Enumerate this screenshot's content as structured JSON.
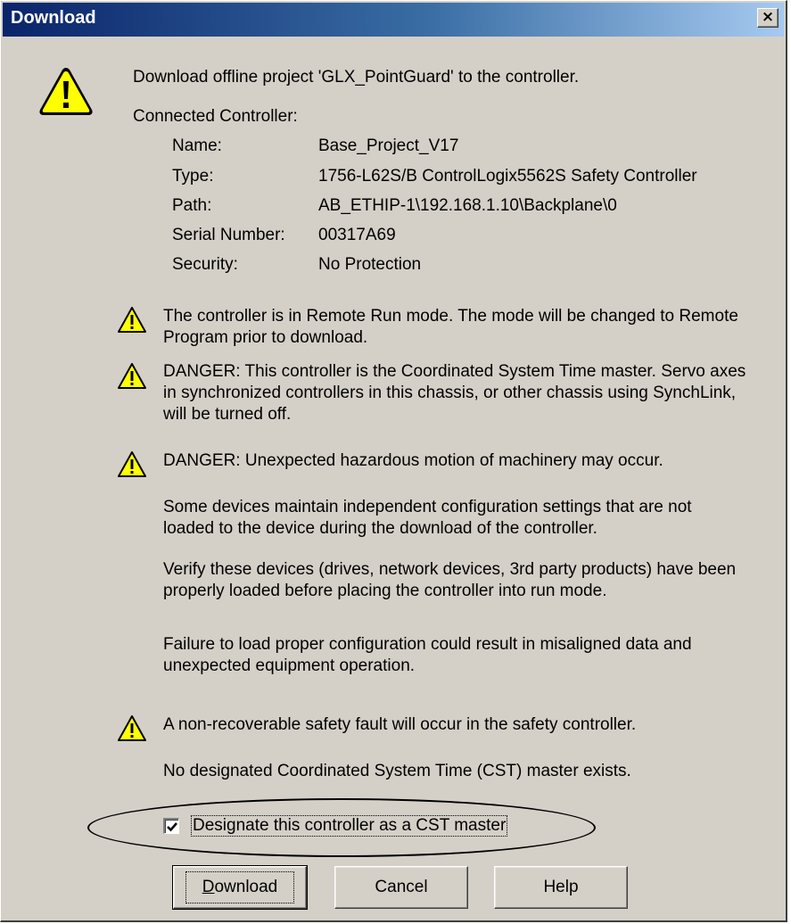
{
  "window": {
    "title": "Download",
    "close_label": "×"
  },
  "intro": "Download offline project 'GLX_PointGuard' to the controller.",
  "controller": {
    "heading": "Connected Controller:",
    "name_label": "Name:",
    "name_value": "Base_Project_V17",
    "type_label": "Type:",
    "type_value": "1756-L62S/B ControlLogix5562S Safety Controller",
    "path_label": "Path:",
    "path_value": "AB_ETHIP-1\\192.168.1.10\\Backplane\\0",
    "serial_label": "Serial Number:",
    "serial_value": "00317A69",
    "security_label": "Security:",
    "security_value": "No Protection"
  },
  "warnings": {
    "w1": "The controller is in Remote Run mode. The mode will be changed to Remote Program prior to download.",
    "w2": "DANGER: This controller is the Coordinated System Time master. Servo axes in synchronized controllers in this chassis, or other chassis using SynchLink, will be turned off.",
    "w3": "DANGER: Unexpected hazardous motion of machinery may occur.",
    "w3_p1": "Some devices maintain independent configuration settings that are not loaded to the device during the download of the controller.",
    "w3_p2": "Verify these devices (drives, network devices, 3rd party products) have been properly loaded before placing the controller into run mode.",
    "w3_p3": "Failure to load proper configuration could result in misaligned data and unexpected equipment operation.",
    "w4": "A non-recoverable safety fault will occur in the safety controller.",
    "w4_p1": "No designated Coordinated System Time (CST) master exists."
  },
  "cst_checkbox": {
    "label": "Designate this controller as a CST master",
    "checked": true
  },
  "buttons": {
    "download": "Download",
    "cancel": "Cancel",
    "help": "Help"
  },
  "icons": {
    "large": "warning-icon",
    "small": "warning-icon"
  },
  "colors": {
    "dialog_bg": "#d4d0c8",
    "title_start": "#0a246a",
    "title_end": "#a6caf0",
    "warning_yellow": "#ffff00"
  }
}
